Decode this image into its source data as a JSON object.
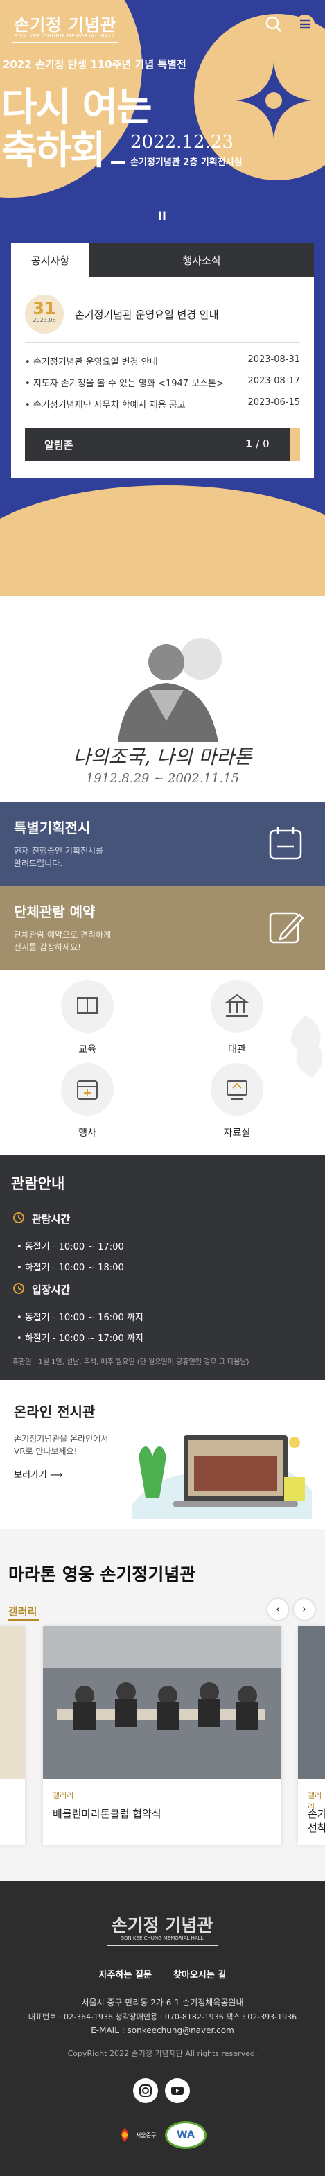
{
  "header": {
    "logo_main": "손기정 기념관",
    "logo_sub": "SON KEE CHUNG MEMORIAL HALL"
  },
  "hero": {
    "kicker": "2022 손기정 탄생 110주년 기념 특별전",
    "headline_1": "다시 여는",
    "headline_2": "축하회",
    "date": "2022.12.23",
    "venue": "손기정기념관 2층 기획전시실",
    "pause_label": "II"
  },
  "notice": {
    "tabs": [
      "공지사항",
      "행사소식"
    ],
    "featured": {
      "day": "31",
      "ym": "2023.08",
      "title": "손기정기념관 운영요일 변경 안내"
    },
    "items": [
      {
        "title": "손기정기념관 운영요일 변경 안내",
        "date": "2023-08-31"
      },
      {
        "title": "지도자 손기정을 볼 수 있는 영화 <1947 보스톤>",
        "date": "2023-08-17"
      },
      {
        "title": "손기정기념재단 사무처 학예사 채용 공고",
        "date": "2023-06-15"
      }
    ],
    "bar": {
      "label": "알림존",
      "current": "1",
      "sep": "/",
      "total": "0"
    }
  },
  "quote": {
    "line1": "나의조국, 나의 마라톤",
    "line2": "1912.8.29 ~ 2002.11.15"
  },
  "special": {
    "title": "특별기획전시",
    "desc_1": "현재 진행중인 기획전시를",
    "desc_2": "알려드립니다."
  },
  "group": {
    "title": "단체관람 예약",
    "desc_1": "단체관람 예약으로 편리하게",
    "desc_2": "전시를 감상하세요!"
  },
  "quick": [
    {
      "label": "교육",
      "icon": "book-icon"
    },
    {
      "label": "대관",
      "icon": "building-icon"
    },
    {
      "label": "행사",
      "icon": "calendar-icon"
    },
    {
      "label": "자료실",
      "icon": "archive-icon"
    }
  ],
  "guide": {
    "title": "관람안내",
    "hours_title": "관람시간",
    "hours": [
      "동절기 - 10:00 ~ 17:00",
      "하절기 - 10:00 ~ 18:00"
    ],
    "entry_title": "입장시간",
    "entry": [
      "동절기 - 10:00 ~ 16:00 까지",
      "하절기 - 10:00 ~ 17:00 까지"
    ],
    "closed": "휴관일 : 1월 1일, 설날, 추석, 매주 월요일 (단 월요일이 공휴일인 경우 그 다음날)"
  },
  "online": {
    "title": "온라인 전시관",
    "desc_1": "손기정기념관을 온라인에서",
    "desc_2": "VR로 만나보세요!",
    "more": "보러가기"
  },
  "gallery": {
    "heading": "마라톤 영웅 손기정기념관",
    "tab": "갤러리",
    "cards": [
      {
        "category": "갤러리",
        "title": "베를린마라톤클럽 협약식"
      },
      {
        "category": "갤러리",
        "title": "손기"
      },
      {
        "category": "",
        "title": "선착"
      }
    ]
  },
  "footer": {
    "logo_main": "손기정 기념관",
    "logo_sub": "SON KEE CHUNG MEMORIAL HALL",
    "links": [
      "자주하는 질문",
      "찾아오시는 길"
    ],
    "address": "서울시 중구 만리동 2가 6-1 손기정체육공원내",
    "contact": "대표번호 : 02-364-1936   청각장애인용 : 070-8182-1936   팩스 : 02-393-1936",
    "email": "E-MAIL : sonkeechung@naver.com",
    "copyright": "CopyRight 2022 손기정 기념재단 All rights reserved.",
    "badge_1": "서울중구",
    "badge_2": "WA"
  },
  "colors": {
    "hero_blue": "#2f3f9a",
    "gold": "#f0c889",
    "accent_orange": "#d9a23a",
    "navy_band": "#46547a",
    "tan_band": "#a28f6c",
    "dark_band": "#333438"
  }
}
